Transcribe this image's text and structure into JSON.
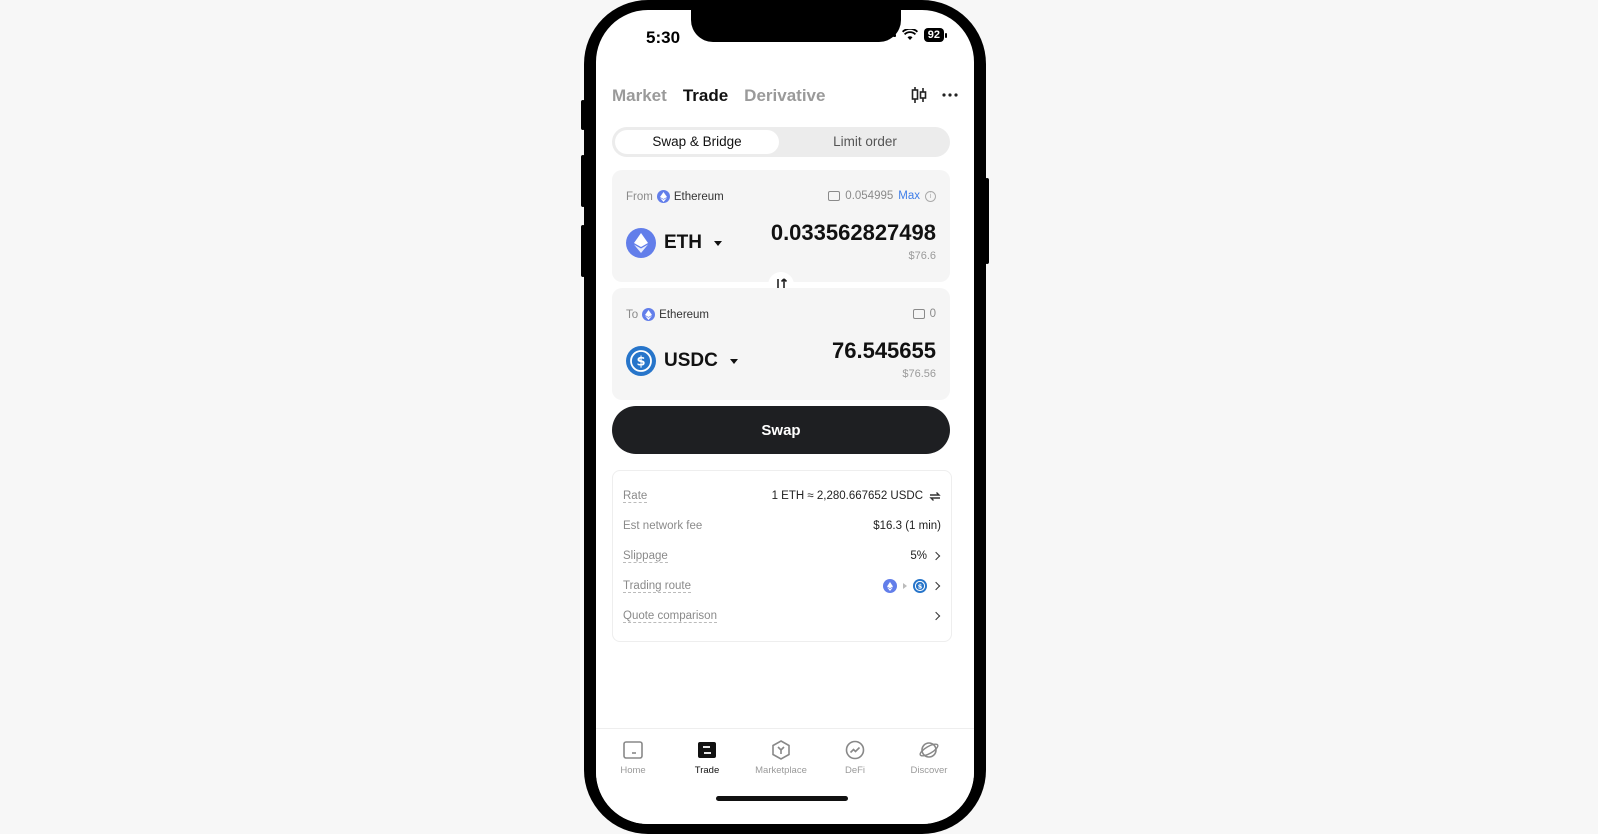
{
  "status_bar": {
    "time": "5:30",
    "battery": "92"
  },
  "top_tabs": [
    {
      "label": "Market",
      "active": false
    },
    {
      "label": "Trade",
      "active": true
    },
    {
      "label": "Derivative",
      "active": false
    }
  ],
  "segment": {
    "active": "Swap & Bridge",
    "inactive": "Limit order"
  },
  "from": {
    "prefix": "From",
    "chain": "Ethereum",
    "balance": "0.054995",
    "max_label": "Max",
    "token": "ETH",
    "amount": "0.033562827498",
    "usd": "$76.6"
  },
  "to": {
    "prefix": "To",
    "chain": "Ethereum",
    "balance": "0",
    "token": "USDC",
    "amount": "76.545655",
    "usd": "$76.56"
  },
  "swap_button": "Swap",
  "details": {
    "rate_label": "Rate",
    "rate_value": "1 ETH ≈ 2,280.667652 USDC",
    "fee_label": "Est network fee",
    "fee_value": "$16.3 (1 min)",
    "slippage_label": "Slippage",
    "slippage_value": "5%",
    "route_label": "Trading route",
    "quote_label": "Quote comparison"
  },
  "bottom_nav": [
    {
      "label": "Home",
      "active": false
    },
    {
      "label": "Trade",
      "active": true
    },
    {
      "label": "Marketplace",
      "active": false
    },
    {
      "label": "DeFi",
      "active": false
    },
    {
      "label": "Discover",
      "active": false
    }
  ],
  "colors": {
    "eth": "#627eea",
    "usdc": "#2775ca",
    "max": "#3f7ee8",
    "button": "#1e1f22"
  }
}
